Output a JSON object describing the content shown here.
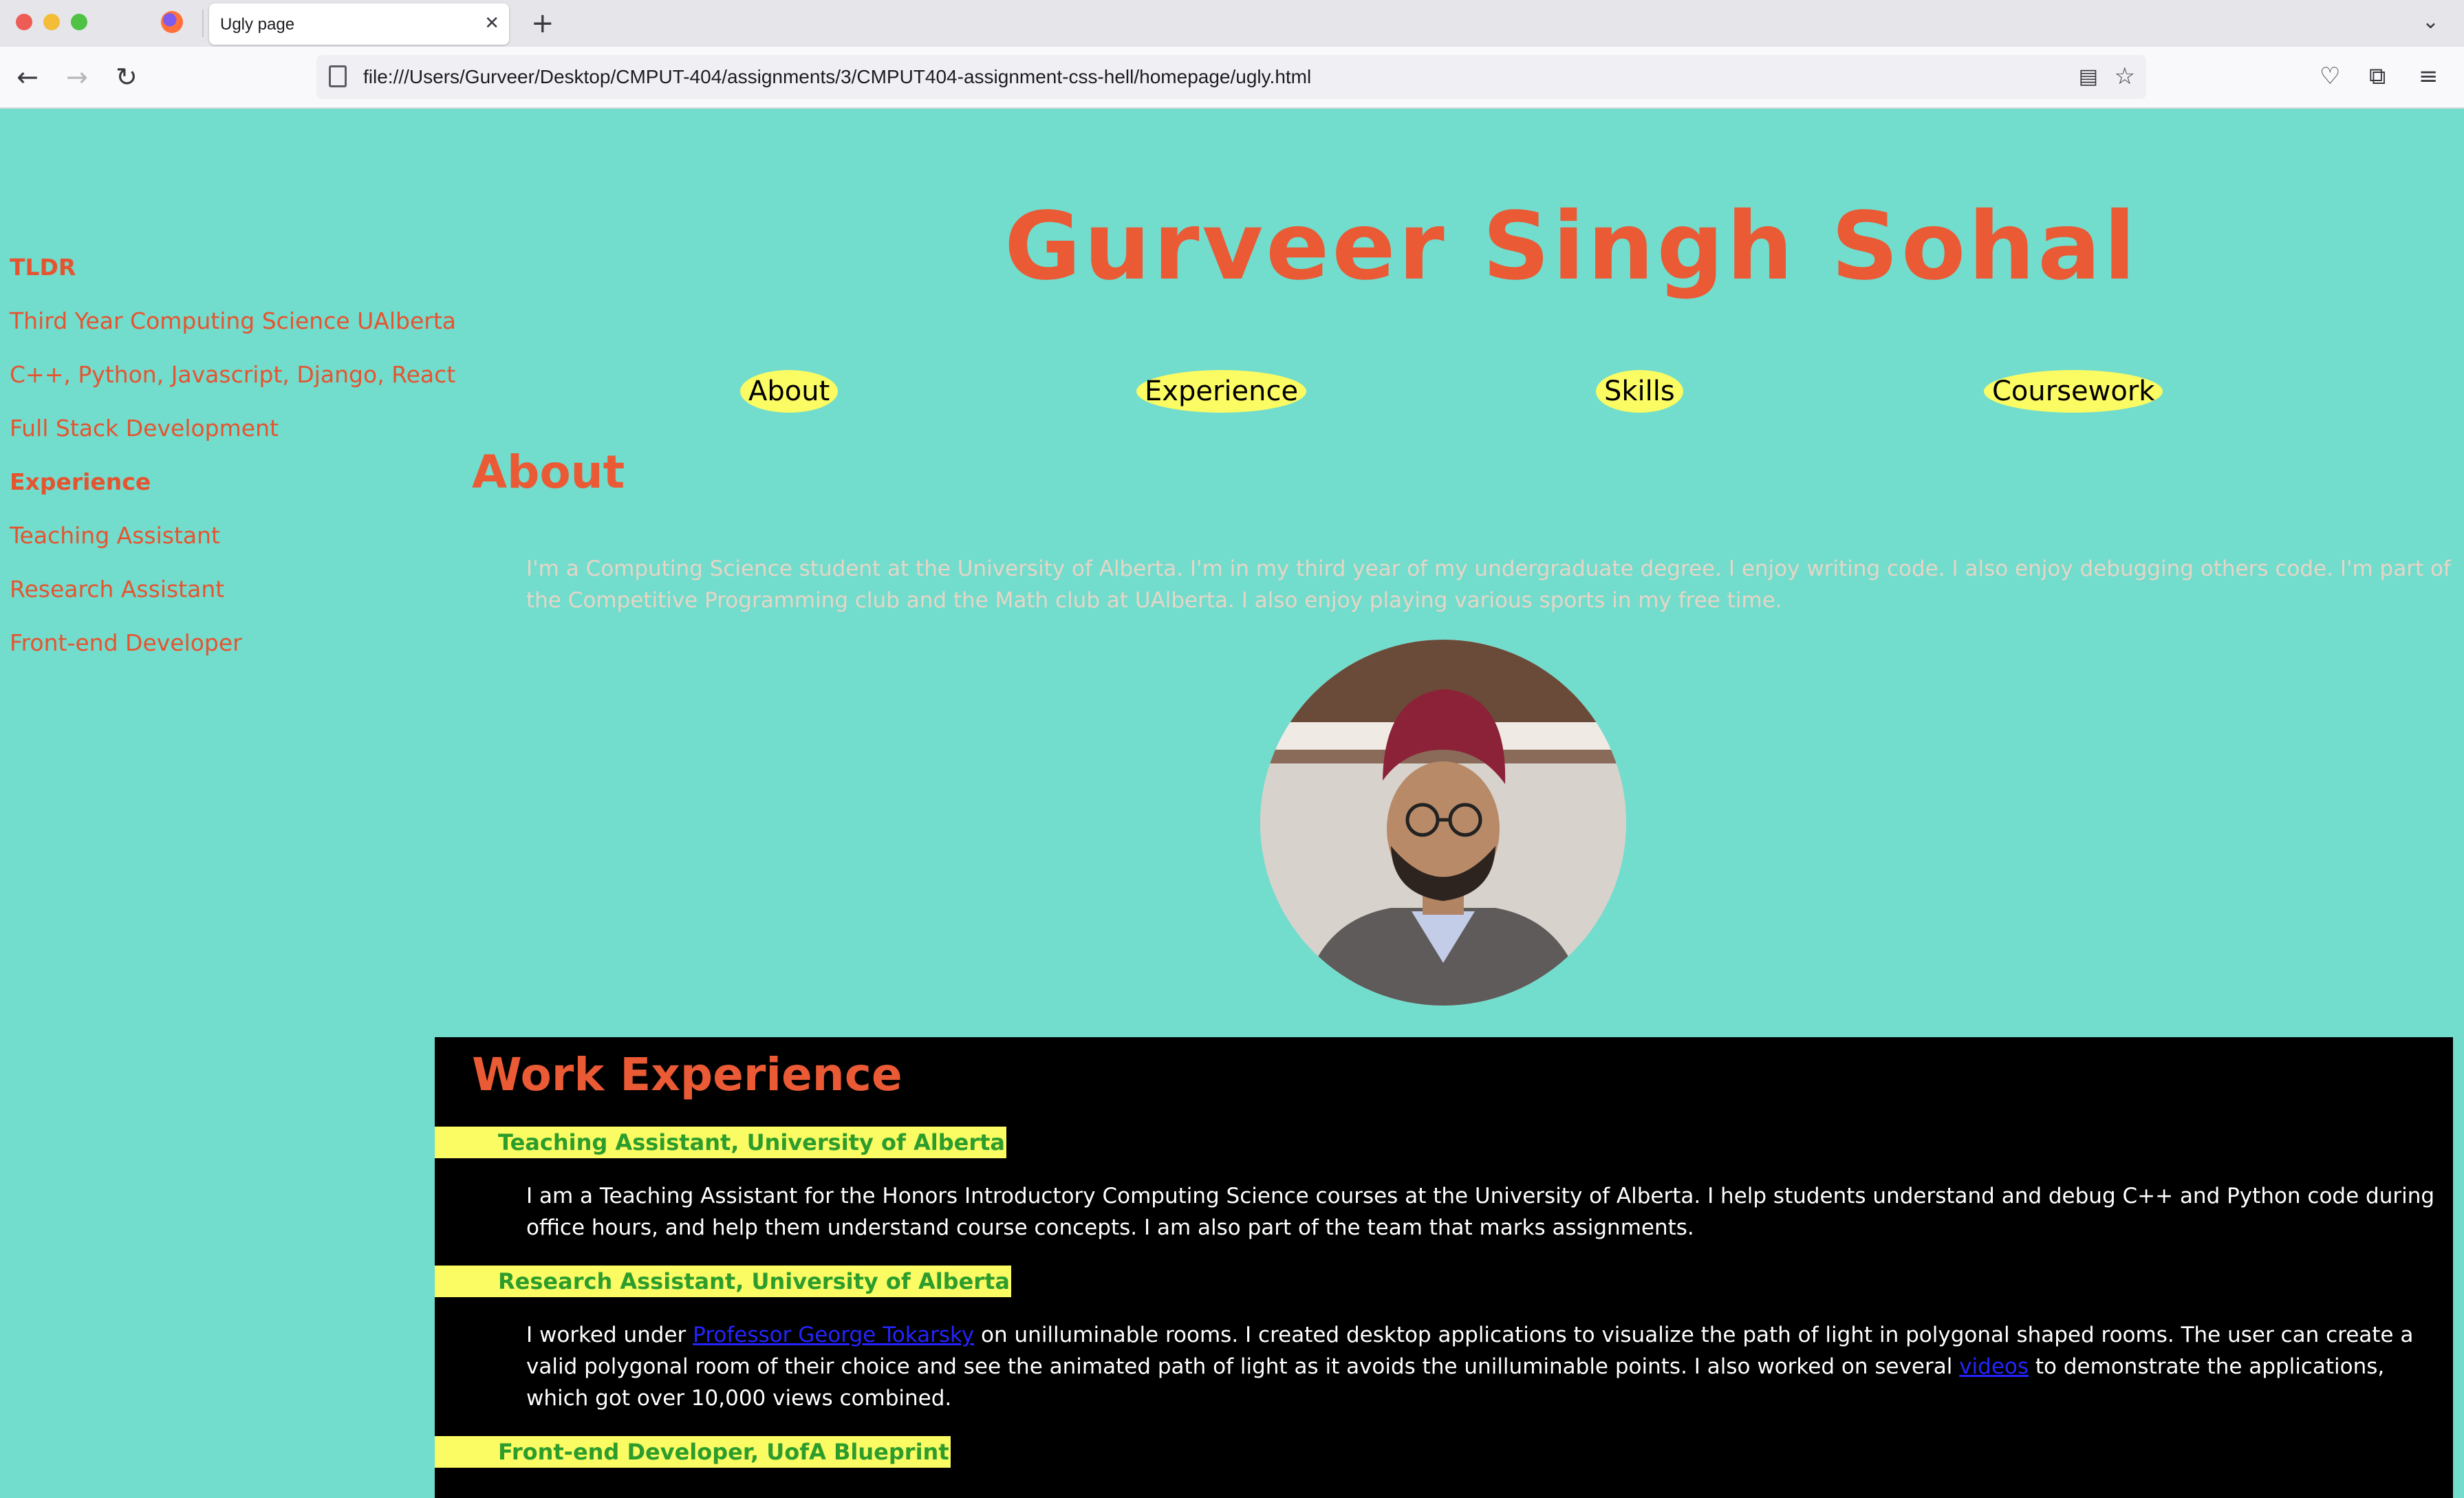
{
  "browser": {
    "tab_title": "Ugly page",
    "url": "file:///Users/Gurveer/Desktop/CMPUT-404/assignments/3/CMPUT404-assignment-css-hell/homepage/ugly.html"
  },
  "sidebar": {
    "items": [
      {
        "label": "TLDR",
        "heading": true
      },
      {
        "label": "Third Year Computing Science UAlberta",
        "heading": false
      },
      {
        "label": "C++, Python, Javascript, Django, React",
        "heading": false
      },
      {
        "label": "Full Stack Development",
        "heading": false
      },
      {
        "label": "Experience",
        "heading": true
      },
      {
        "label": "Teaching Assistant",
        "heading": false
      },
      {
        "label": "Research Assistant",
        "heading": false
      },
      {
        "label": "Front-end Developer",
        "heading": false
      }
    ]
  },
  "header": {
    "name": "Gurveer Singh Sohal"
  },
  "nav": {
    "about": "About",
    "experience": "Experience",
    "skills": "Skills",
    "coursework": "Coursework"
  },
  "about": {
    "heading": "About",
    "text": "I'm a Computing Science student at the University of Alberta. I'm in my third year of my undergraduate degree. I enjoy writing code. I also enjoy debugging others code. I'm part of the Competitive Programming club and the Math club at UAlberta. I also enjoy playing various sports in my free time."
  },
  "work": {
    "heading": "Work Experience",
    "jobs": [
      {
        "title": "Teaching Assistant, University of Alberta",
        "text": "I am a Teaching Assistant for the Honors Introductory Computing Science courses at the University of Alberta. I help students understand and debug C++ and Python code during office hours, and help them understand course concepts. I am also part of the team that marks assignments."
      },
      {
        "title": "Research Assistant, University of Alberta",
        "text_before": "I worked under ",
        "link1": "Professor George Tokarsky",
        "text_middle": " on unilluminable rooms. I created desktop applications to visualize the path of light in polygonal shaped rooms. The user can create a valid polygonal room of their choice and see the animated path of light as it avoids the unilluminable points. I also worked on several ",
        "link2": "videos",
        "text_after": " to demonstrate the applications, which got over 10,000 views combined."
      },
      {
        "title": "Front-end Developer, UofA Blueprint"
      }
    ]
  },
  "colors": {
    "page_background": "#72dccd",
    "heading": "#ea5a35",
    "pill": "#fbfb63",
    "job_title_text": "#2c9d2c",
    "work_background": "#000000"
  },
  "icons": [
    "firefox-icon",
    "tab-close-icon",
    "new-tab-icon",
    "tab-list-icon",
    "back-icon",
    "forward-icon",
    "reload-icon",
    "page-icon",
    "reader-view-icon",
    "bookmark-star-icon",
    "pocket-icon",
    "extensions-icon",
    "menu-icon"
  ]
}
